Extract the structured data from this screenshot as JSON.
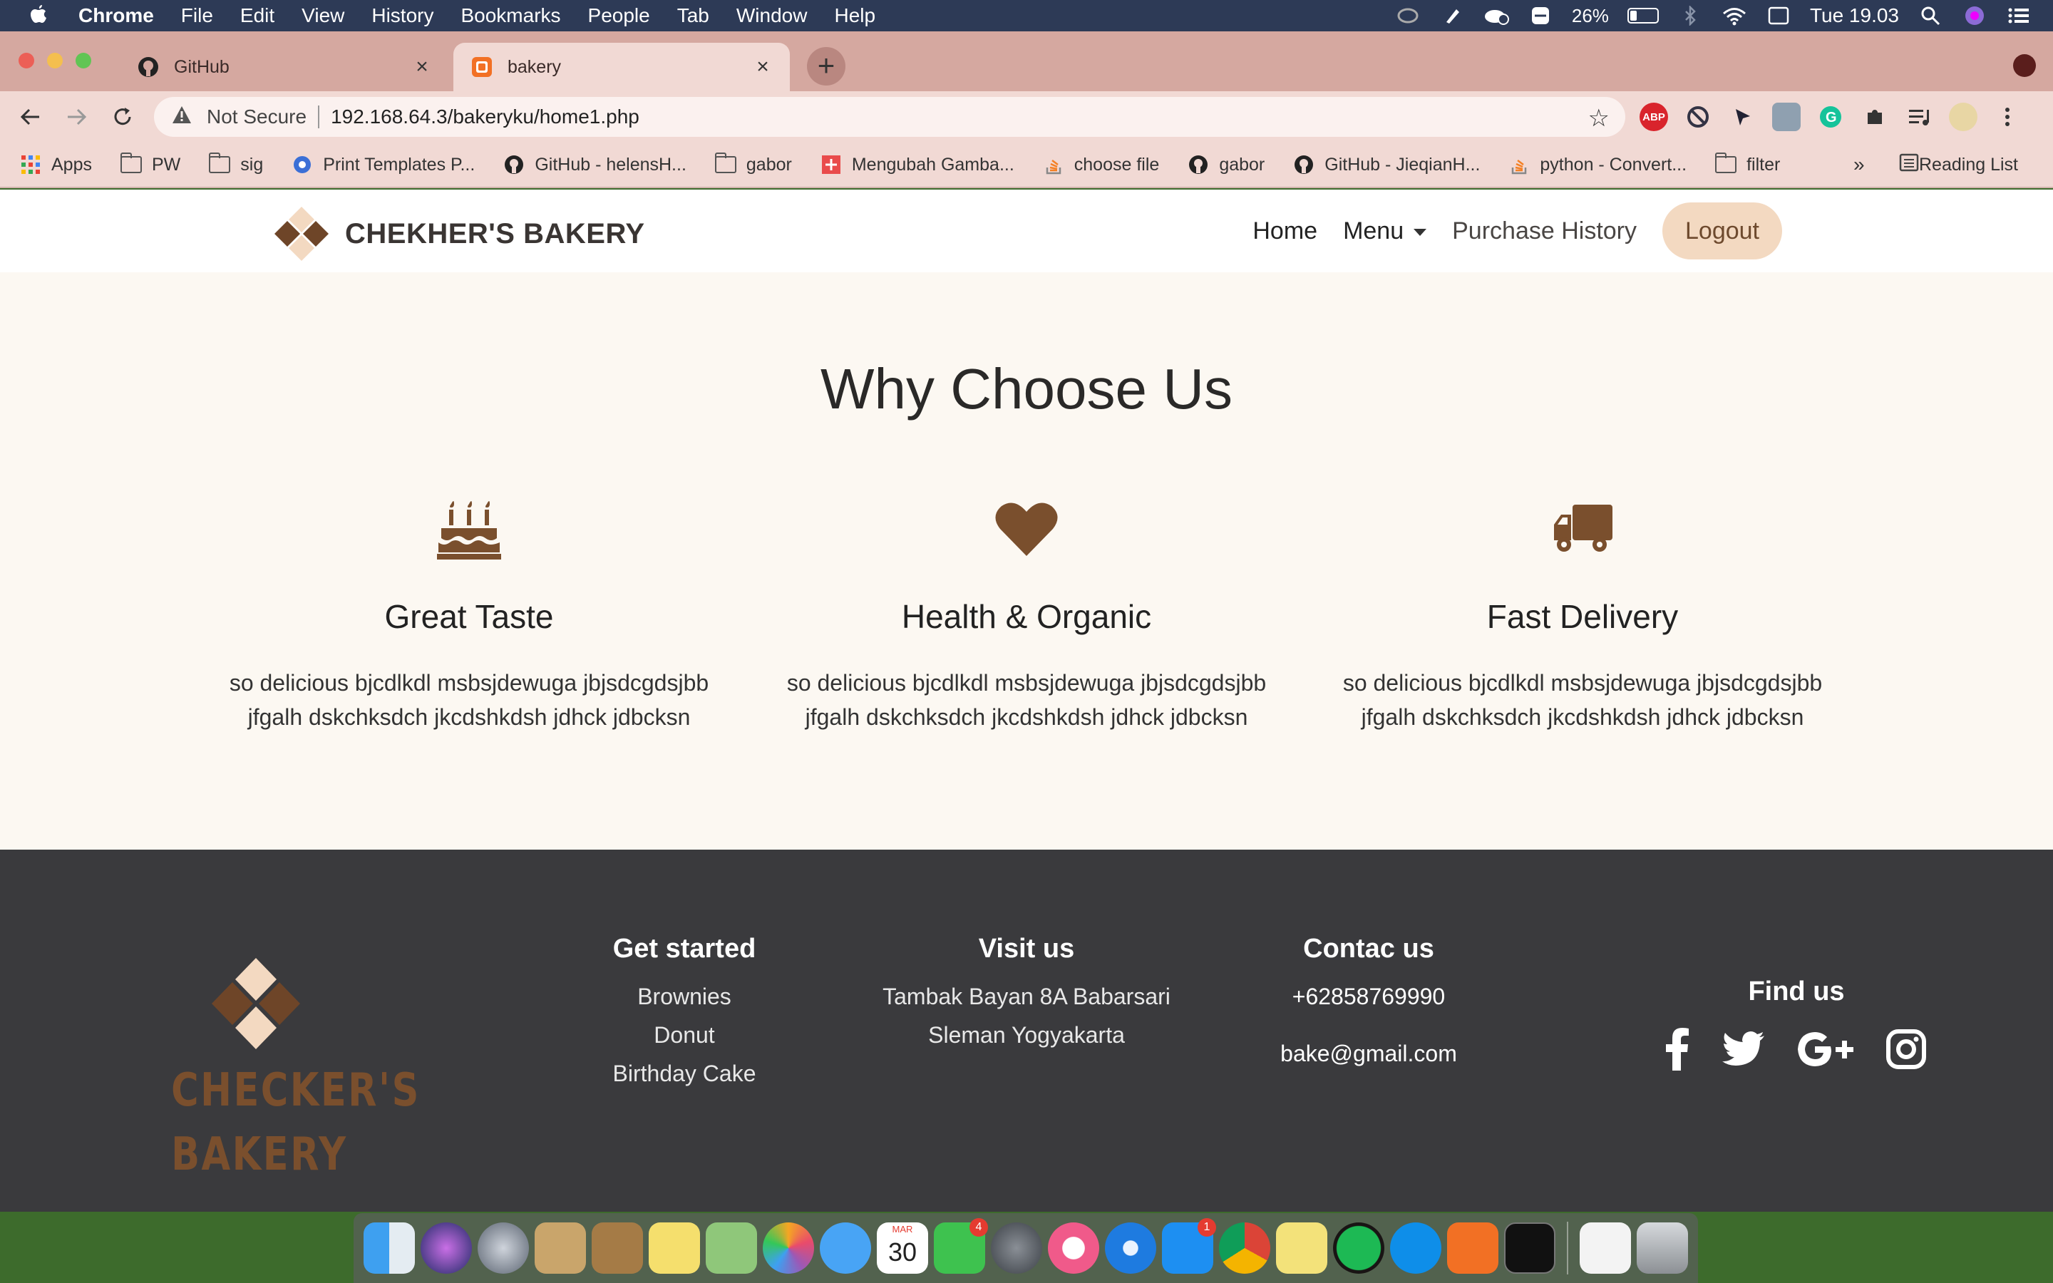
{
  "menubar": {
    "items": [
      "Chrome",
      "File",
      "Edit",
      "View",
      "History",
      "Bookmarks",
      "People",
      "Tab",
      "Window",
      "Help"
    ],
    "battery": "26%",
    "battery_level": 0.26,
    "clock": "Tue 19.03"
  },
  "tabs": [
    {
      "title": "GitHub"
    },
    {
      "title": "bakery"
    }
  ],
  "omnibox": {
    "security": "Not Secure",
    "url": "192.168.64.3/bakeryku/home1.php"
  },
  "bookmarks": {
    "items": [
      "Apps",
      "PW",
      "sig",
      "Print Templates P...",
      "GitHub - helensH...",
      "gabor",
      "Mengubah Gamba...",
      "choose file",
      "gabor",
      "GitHub - JieqianH...",
      "python - Convert...",
      "filter"
    ],
    "more": "»",
    "reading_list": "Reading List"
  },
  "site": {
    "brand": "CHEKHER'S BAKERY",
    "nav": {
      "home": "Home",
      "menu": "Menu",
      "history": "Purchase History",
      "logout": "Logout"
    }
  },
  "why": {
    "title": "Why Choose Us",
    "features": [
      {
        "icon": "birthday-cake-icon",
        "title": "Great Taste",
        "line1": "so delicious bjcdlkdl msbsjdewuga jbjsdcgdsjbb",
        "line2": "jfgalh dskchksdch jkcdshkdsh jdhck jdbcksn"
      },
      {
        "icon": "heart-icon",
        "title": "Health & Organic",
        "line1": "so delicious bjcdlkdl msbsjdewuga jbjsdcgdsjbb",
        "line2": "jfgalh dskchksdch jkcdshkdsh jdhck jdbcksn"
      },
      {
        "icon": "truck-icon",
        "title": "Fast Delivery",
        "line1": "so delicious bjcdlkdl msbsjdewuga jbjsdcgdsjbb",
        "line2": "jfgalh dskchksdch jkcdshkdsh jdhck jdbcksn"
      }
    ]
  },
  "footer": {
    "logo_line1": "CHECKER'S",
    "logo_line2": "BAKERY",
    "get_started": {
      "title": "Get started",
      "items": [
        "Brownies",
        "Donut",
        "Birthday Cake"
      ]
    },
    "visit": {
      "title": "Visit us",
      "line1": "Tambak Bayan 8A Babarsari",
      "line2": "Sleman Yogyakarta"
    },
    "contact": {
      "title": "Contac us",
      "phone": "+62858769990",
      "email": "bake@gmail.com"
    },
    "find": {
      "title": "Find us",
      "icons": [
        "facebook-icon",
        "twitter-icon",
        "google-plus-icon",
        "instagram-icon"
      ]
    }
  },
  "dock": {
    "calendar_month": "MAR",
    "calendar_day": "30",
    "facetime_badge": "4",
    "appstore_badge": "1"
  },
  "colors": {
    "brand_brown": "#7a4f2d",
    "page_bg": "#fcf8f2",
    "footer_bg": "#3a3a3d",
    "logout_bg": "#f3d9c1",
    "tab_strip": "#d5a8a0"
  }
}
